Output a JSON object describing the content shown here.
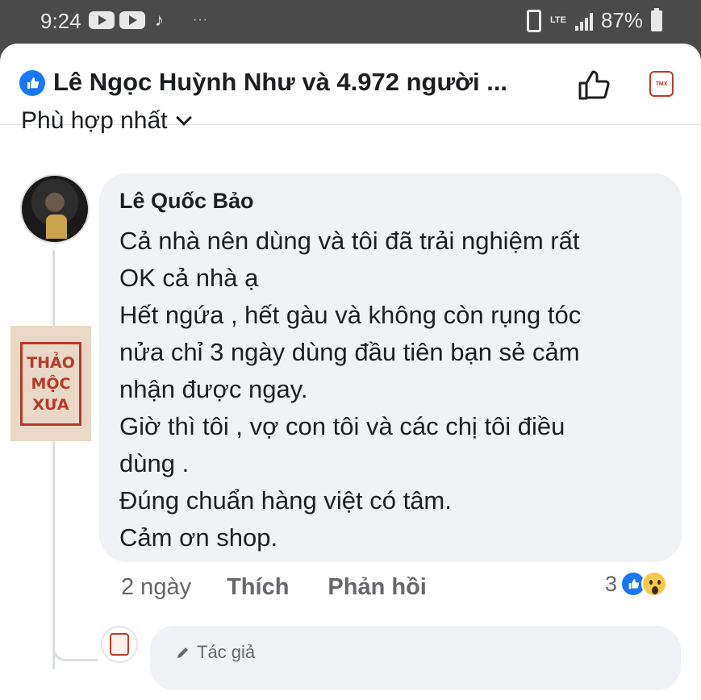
{
  "status_bar": {
    "time": "9:24",
    "battery": "87%",
    "network": "LTE"
  },
  "header": {
    "title": "Lê Ngọc Huỳnh Như và 4.972 người ...",
    "brand_text": "THAO MỘC XƯA"
  },
  "sort": {
    "label": "Phù hợp nhất"
  },
  "comment": {
    "author": "Lê Quốc Bảo",
    "lines": [
      "Cả nhà nên dùng và tôi đã trải nghiệm rất",
      "OK cả nhà ạ",
      "Hết ngứa , hết gàu và không còn rụng tóc",
      "nửa chỉ 3 ngày dùng đầu tiên bạn sẻ cảm",
      "nhận được ngay.",
      "Giờ thì tôi , vợ con tôi và các chị tôi điều",
      "dùng .",
      "Đúng chuẩn hàng việt có tâm.",
      "Cảm ơn shop."
    ],
    "time": "2 ngày",
    "like_label": "Thích",
    "reply_label": "Phản hồi",
    "reaction_count": "3"
  },
  "stamp": {
    "line1": "THẢO",
    "line2": "MỘC",
    "line3": "XƯA"
  },
  "reply": {
    "author_tag": "Tác giả"
  },
  "colors": {
    "facebook_blue": "#1877f2",
    "bubble_bg": "#f0f2f5",
    "brand_red": "#b73a2a"
  }
}
